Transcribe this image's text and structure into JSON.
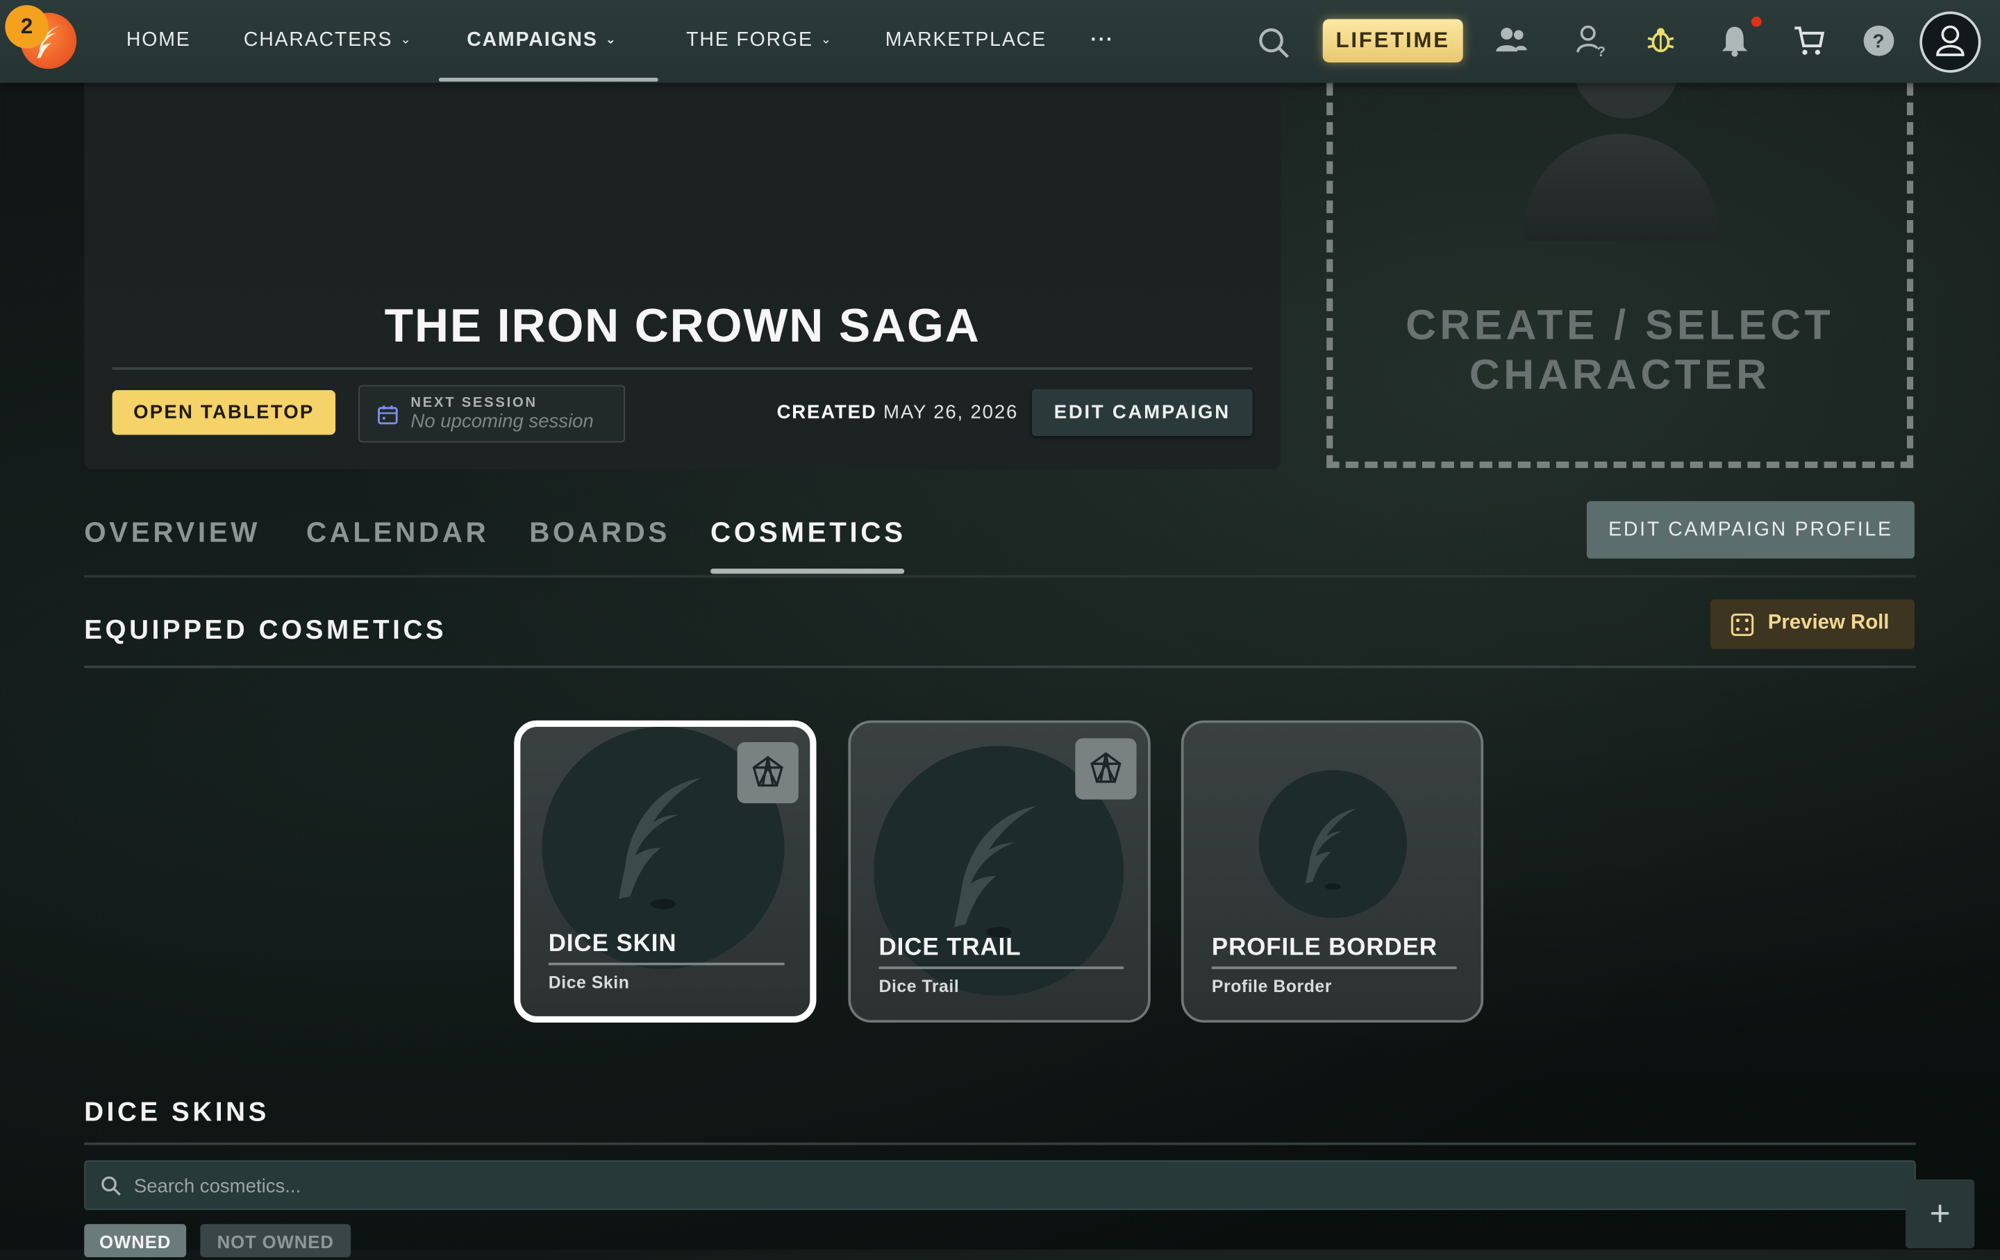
{
  "nav": {
    "badge_count": "2",
    "items": [
      {
        "label": "HOME"
      },
      {
        "label": "CHARACTERS"
      },
      {
        "label": "CAMPAIGNS"
      },
      {
        "label": "THE FORGE"
      },
      {
        "label": "MARKETPLACE"
      },
      {
        "label": "···"
      }
    ],
    "lifetime_label": "LIFETIME",
    "icons": [
      "search-icon",
      "friends-icon",
      "player-lookup-icon",
      "bug-icon",
      "bell-icon",
      "cart-icon",
      "help-icon",
      "profile-icon"
    ]
  },
  "campaign": {
    "title": "THE IRON CROWN SAGA",
    "open_tabletop": "OPEN TABLETOP",
    "next_session_label": "NEXT SESSION",
    "next_session_value": "No upcoming session",
    "created_label": "CREATED",
    "created_date": "MAY 26, 2026",
    "edit_campaign": "EDIT CAMPAIGN"
  },
  "character_slot": {
    "text": "CREATE / SELECT CHARACTER"
  },
  "tabs": [
    {
      "label": "OVERVIEW"
    },
    {
      "label": "CALENDAR"
    },
    {
      "label": "BOARDS"
    },
    {
      "label": "COSMETICS"
    }
  ],
  "edit_profile_label": "EDIT CAMPAIGN PROFILE",
  "equipped": {
    "title": "EQUIPPED COSMETICS",
    "preview_label": "Preview Roll",
    "cards": [
      {
        "name": "DICE SKIN",
        "sub": "Dice Skin"
      },
      {
        "name": "DICE TRAIL",
        "sub": "Dice Trail"
      },
      {
        "name": "PROFILE BORDER",
        "sub": "Profile Border"
      }
    ]
  },
  "dice_skins": {
    "title": "DICE SKINS",
    "search_placeholder": "Search cosmetics...",
    "filter_owned": "OWNED",
    "filter_not_owned": "NOT OWNED",
    "fab": "+"
  },
  "colors": {
    "accent_yellow": "#f5d368",
    "lifetime_gold": "#e9c870",
    "nav_bg": "#2c3b3a"
  }
}
